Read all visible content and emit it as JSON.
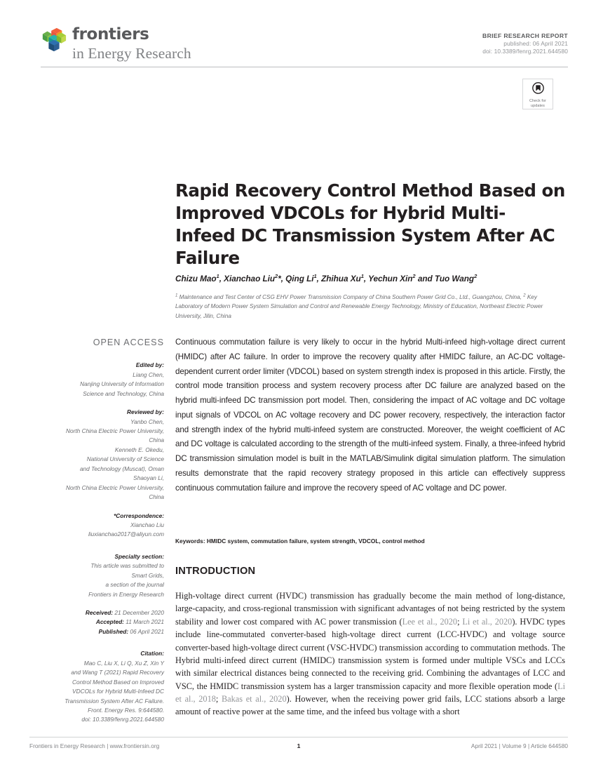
{
  "journal": {
    "logo_name": "frontiers-logo",
    "brand_top": "frontiers",
    "brand_bottom": "in Energy Research",
    "logo_colors": [
      "#4aa751",
      "#e8573f",
      "#25a8a0",
      "#1f4e79",
      "#8cc63f",
      "#f7941e",
      "#2e3192"
    ]
  },
  "header": {
    "article_type": "BRIEF RESEARCH REPORT",
    "published": "published: 06 April 2021",
    "doi": "doi: 10.3389/fenrg.2021.644580"
  },
  "check_updates": {
    "label_line1": "Check for",
    "label_line2": "updates",
    "icon": "crossmark-icon"
  },
  "article": {
    "title": "Rapid Recovery Control Method Based on Improved VDCOLs for Hybrid Multi-Infeed DC Transmission System After AC Failure",
    "authors_html": "Chizu Mao<sup>1</sup>, Xianchao Liu<sup>2</sup>*, Qing Li<sup>1</sup>, Zhihua Xu<sup>1</sup>, Yechun Xin<sup>2</sup> and Tuo Wang<sup>2</sup>",
    "affiliations_html": "<sup>1</sup> Maintenance and Test Center of CSG EHV Power Transmission Company of China Southern Power Grid Co., Ltd., Guangzhou, China, <sup>2</sup> Key Laboratory of Modern Power System Simulation and Control and Renewable Energy Technology, Ministry of Education, Northeast Electric Power University, Jilin, China"
  },
  "sidebar": {
    "open_access": "OPEN ACCESS",
    "edited_by_head": "Edited by:",
    "edited_by_lines": [
      "Liang Chen,",
      "Nanjing University of Information",
      "Science and Technology, China"
    ],
    "reviewed_by_head": "Reviewed by:",
    "reviewed_by_lines": [
      "Yanbo Chen,",
      "North China Electric Power University,",
      "China",
      "Kenneth E. Okedu,",
      "National University of Science",
      "and Technology (Muscat), Oman",
      "Shaoyan Li,",
      "North China Electric Power University,",
      "China"
    ],
    "correspondence_head": "*Correspondence:",
    "correspondence_lines": [
      "Xianchao Liu",
      "liuxianchao2017@aliyun.com"
    ],
    "specialty_head": "Specialty section:",
    "specialty_lines": [
      "This article was submitted to",
      "Smart Grids,",
      "a section of the journal",
      "Frontiers in Energy Research"
    ],
    "received_label": "Received:",
    "received_value": "21 December 2020",
    "accepted_label": "Accepted:",
    "accepted_value": "11 March 2021",
    "published_label": "Published:",
    "published_value": "06 April 2021",
    "citation_head": "Citation:",
    "citation_lines": [
      "Mao C, Liu X, Li Q, Xu Z, Xin Y",
      "and Wang T (2021) Rapid Recovery",
      "Control Method Based on Improved",
      "VDCOLs for Hybrid Multi-Infeed DC",
      "Transmission System After AC Failure.",
      "Front. Energy Res. 9:644580.",
      "doi: 10.3389/fenrg.2021.644580"
    ]
  },
  "abstract": {
    "text": "Continuous commutation failure is very likely to occur in the hybrid Multi-infeed high-voltage direct current (HMIDC) after AC failure. In order to improve the recovery quality after HMIDC failure, an AC-DC voltage-dependent current order limiter (VDCOL) based on system strength index is proposed in this article. Firstly, the control mode transition process and system recovery process after DC failure are analyzed based on the hybrid multi-infeed DC transmission port model. Then, considering the impact of AC voltage and DC voltage input signals of VDCOL on AC voltage recovery and DC power recovery, respectively, the interaction factor and strength index of the hybrid multi-infeed system are constructed. Moreover, the weight coefficient of AC and DC voltage is calculated according to the strength of the multi-infeed system. Finally, a three-infeed hybrid DC transmission simulation model is built in the MATLAB/Simulink digital simulation platform. The simulation results demonstrate that the rapid recovery strategy proposed in this article can effectively suppress continuous commutation failure and improve the recovery speed of AC voltage and DC power.",
    "keywords": "Keywords: HMIDC system, commutation failure, system strength, VDCOL, control method"
  },
  "introduction": {
    "heading": "INTRODUCTION",
    "paragraph_html": "High-voltage direct current (HVDC) transmission has gradually become the main method of long-distance, large-capacity, and cross-regional transmission with significant advantages of not being restricted by the system stability and lower cost compared with AC power transmission (<span class=\"cite\">Lee et al., 2020</span>; <span class=\"cite\">Li et al., 2020</span>). HVDC types include line-commutated converter-based high-voltage direct current (LCC-HVDC) and voltage source converter-based high-voltage direct current (VSC-HVDC) transmission according to commutation methods. The Hybrid multi-infeed direct current (HMIDC) transmission system is formed under multiple VSCs and LCCs with similar electrical distances being connected to the receiving grid. Combining the advantages of LCC and VSC, the HMIDC transmission system has a larger transmission capacity and more flexible operation mode (<span class=\"cite\">Li et al., 2018</span>; <span class=\"cite\">Bakas et al., 2020</span>). However, when the receiving power grid fails, LCC stations absorb a large amount of reactive power at the same time, and the infeed bus voltage with a short"
  },
  "footer": {
    "left": "Frontiers in Energy Research | www.frontiersin.org",
    "page_number": "1",
    "right": "April 2021 | Volume 9 | Article 644580"
  }
}
